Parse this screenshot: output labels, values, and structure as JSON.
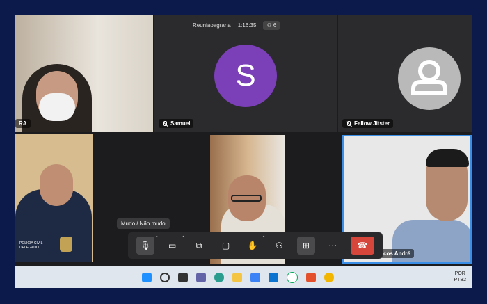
{
  "meeting": {
    "title": "Reuniaoagraria",
    "timer": "1:16:35",
    "participants": "6"
  },
  "tiles": [
    {
      "name": "RA"
    },
    {
      "name": "Samuel",
      "avatar_letter": "S"
    },
    {
      "name": "Fellow Jitster"
    },
    {
      "name": ""
    },
    {
      "name": ""
    },
    {
      "name": "cos André"
    }
  ],
  "badge_text": "POLÍCIA CIVIL\nDELEGADO",
  "toolbar": {
    "tooltip": "Mudo / Não mudo",
    "mic_icon": "mic-off-icon",
    "camera_icon": "camera-icon",
    "share_icon": "screen-share-icon",
    "chat_icon": "chat-icon",
    "hand_icon": "raise-hand-icon",
    "participants_icon": "participants-icon",
    "tiles_icon": "tile-view-icon",
    "more_icon": "more-icon",
    "hangup_icon": "hangup-icon"
  },
  "taskbar": {
    "lang_top": "POR",
    "lang_bottom": "PTB2"
  },
  "colors": {
    "accent_purple": "#7b3fb8",
    "hangup_red": "#d6463a",
    "frame_navy": "#0b1a4a"
  }
}
